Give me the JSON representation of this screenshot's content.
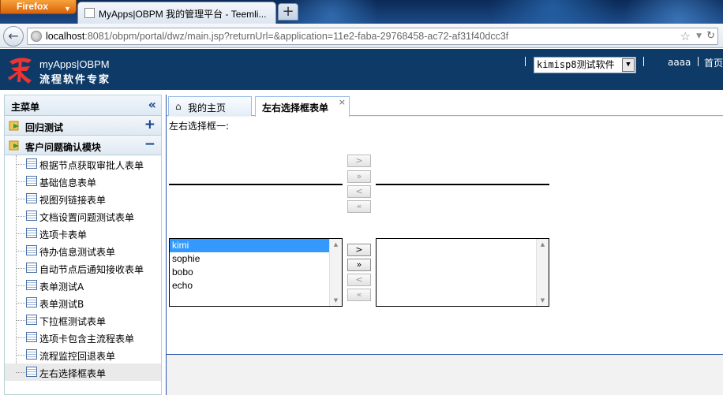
{
  "browser": {
    "menu_label": "Firefox",
    "tab_title": "MyApps|OBPM 我的管理平台 - Teemli...",
    "new_tab_label": "+",
    "url_host": "localhost",
    "url_rest": ":8081/obpm/portal/dwz/main.jsp?returnUrl=&application=11e2-faba-29768458-ac72-af31f40dcc3f"
  },
  "header": {
    "app_name": "myApps|OBPM",
    "app_subtitle": "流程软件专家",
    "app_selector_value": "kimisp8测试软件",
    "user": "aaaa",
    "home_link": "首页"
  },
  "sidebar": {
    "title": "主菜单",
    "groups": [
      {
        "label": "回归测试",
        "toggle": "+"
      },
      {
        "label": "客户问题确认模块",
        "toggle": "−"
      }
    ],
    "items": [
      "根据节点获取审批人表单",
      "基础信息表单",
      "视图列链接表单",
      "文档设置问题测试表单",
      "选项卡表单",
      "待办信息测试表单",
      "自动节点后通知接收表单",
      "表单测试A",
      "表单测试B",
      "下拉框测试表单",
      "选项卡包含主流程表单",
      "流程监控回退表单",
      "左右选择框表单"
    ]
  },
  "tabs": [
    {
      "label": "我的主页"
    },
    {
      "label": "左右选择框表单",
      "close": "×"
    }
  ],
  "form": {
    "label": "左右选择框一:",
    "buttons": [
      ">",
      "»",
      "<",
      "«"
    ],
    "left_options": [
      "kimi",
      "sophie",
      "bobo",
      "echo"
    ],
    "selected_option": "kimi"
  },
  "colors": {
    "header_bg": "#0e3a68",
    "selection": "#3399ff",
    "accent_border": "#2a55a8"
  }
}
